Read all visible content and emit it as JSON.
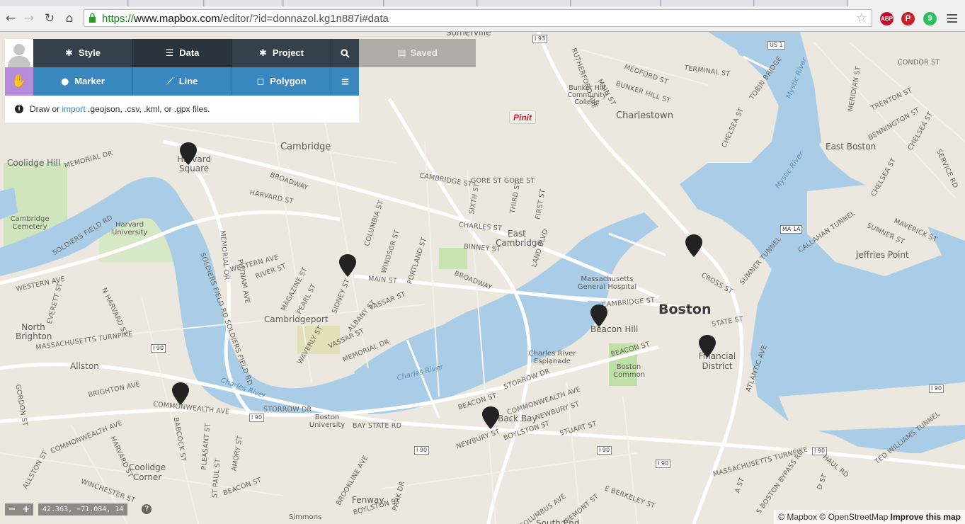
{
  "browser": {
    "url_scheme": "https://",
    "url_host": "www.mapbox.com",
    "url_path": "/editor/?id=donnazol.kg1n887i#data",
    "extensions": [
      {
        "icon": "adblock-icon",
        "label": "ABP",
        "color": "#c70d2c"
      },
      {
        "icon": "pinterest-icon",
        "label": "P",
        "color": "#cb2027"
      },
      {
        "icon": "evernote-icon",
        "label": "9",
        "color": "#2dbe60"
      }
    ]
  },
  "editor": {
    "nav": {
      "style": "Style",
      "data": "Data",
      "project": "Project",
      "saved": "Saved"
    },
    "tools": {
      "marker": "Marker",
      "line": "Line",
      "polygon": "Polygon"
    },
    "hint": {
      "prefix": "Draw or ",
      "link": "import",
      "suffix": " .geojson, .csv, .kml, or .gpx files."
    },
    "accent_color": "#3887be",
    "dark_color": "#34414d",
    "hand_color": "#b78bdb"
  },
  "map": {
    "pinit": "Pinit",
    "coords": "42.363, −71.084, 14",
    "zoom_in": "+",
    "zoom_out": "−",
    "help": "?",
    "attribution": {
      "mapbox": "© Mapbox",
      "osm": "© OpenStreetMap",
      "improve": "Improve this map"
    },
    "labels": {
      "boston": "Boston",
      "cambridge": "Cambridge",
      "charlestown": "Charlestown",
      "east_boston": "East Boston",
      "somerville": "Somerville",
      "harvard_square": "Harvard Square",
      "harvard_university": "Harvard University",
      "coolidge_hill": "Coolidge Hill",
      "cambridge_cemetery": "Cambridge Cemetery",
      "north_brighton": "North Brighton",
      "allston": "Allston",
      "cambridgeport": "Cambridgeport",
      "east_cambridge": "East Cambridge",
      "beacon_hill": "Beacon Hill",
      "back_bay": "Back Bay",
      "financial_district": "Financial District",
      "boston_common": "Boston Common",
      "boston_university": "Boston University",
      "mass_general": "Massachusetts General Hospital",
      "bunker_hill_college": "Bunker Hill Community College",
      "charles_river_esplanade": "Charles River Esplanade",
      "jeffries_point": "Jeffries Point",
      "coolidge_corner": "Coolidge Corner",
      "fenway": "Fenway",
      "simmons": "Simmons",
      "south_end": "South End",
      "charles_river": "Charles River",
      "mystic_river": "Mystic River"
    },
    "streets": {
      "memorial_dr": "MEMORIAL DR",
      "memorial_dr2": "MEMORIAL DR",
      "cambridge_st": "CAMBRIDGE ST",
      "cambridge_st2": "CAMBRIDGE ST",
      "broadway": "BROADWAY",
      "broadway2": "BROADWAY",
      "harvard_st": "HARVARD ST",
      "main_st": "MAIN ST",
      "massachusetts_tpk": "MASSACHUSETTS TURNPIKE",
      "massachusetts_tpk2": "MASSACHUSETTS TURNPIKE",
      "commonwealth_ave": "COMMONWEALTH AVE",
      "commonwealth_ave2": "COMMONWEALTH AVE",
      "commonwealth_ave3": "COMMONWEALTH AVE",
      "storrow_dr": "STORROW DR",
      "storrow_dr2": "STORROW DR",
      "beacon_st": "BEACON ST",
      "beacon_st2": "BEACON ST",
      "beacon_st3": "BEACON ST",
      "western_ave": "WESTERN AVE",
      "western_ave2": "WESTERN AVE",
      "soldiers_field_rd": "SOLDIERS FIELD RD",
      "soldiers_field_rd2": "SOLDIERS FIELD RD SOLDIERS FIELD RD",
      "vassar_st": "VASSAR ST",
      "vassar_st2": "VASSAR ST",
      "albany_st": "ALBANY ST",
      "sidney_st": "SIDNEY ST",
      "columbia_st": "COLUMBIA ST",
      "windsor_st": "WINDSOR ST",
      "portland_st": "PORTLAND ST",
      "gore_st": "GORE ST GORE ST",
      "charles_st": "CHARLES ST",
      "binney_st": "BINNEY ST",
      "land_blvd": "LAND BLVD",
      "sixth_st": "SIXTH ST",
      "third_st": "THIRD ST",
      "first_st": "FIRST ST",
      "river_st": "RIVER ST",
      "magazine_st": "MAGAZINE ST",
      "pearl_st": "PEARL ST",
      "waverly_st": "WAVERLY ST",
      "putnam_ave": "PUTNAM AVE",
      "memorial_dr_v": "MEMORIAL DR",
      "everett_st": "EVERETT ST",
      "n_harvard_st": "N HARVARD ST",
      "brighton_ave": "BRIGHTON AVE",
      "gordon_st": "GORDON ST",
      "babcock_st": "BABCOCK ST",
      "pleasant_st": "PLEASANT ST",
      "st_paul_st": "ST PAUL ST",
      "amory_st": "AMORY ST",
      "harvard_st2": "HARVARD ST",
      "allston_st": "ALLSTON ST",
      "winchester_st": "WINCHESTER ST",
      "newbury_st": "NEWBURY ST",
      "newbury_st2": "NEWBURY ST",
      "boylston_st": "BOYLSTON ST",
      "boylston_st2": "BOYLSTON ST",
      "stuart_st": "STUART ST",
      "bay_state_rd": "BAY STATE RD",
      "brookline_ave": "BROOKLINE AVE",
      "park_dr": "PARK DR",
      "columbus_ave": "COLUMBUS AVE",
      "tremont_st": "TREMONT ST",
      "e_berkeley_st": "E BERKELEY ST",
      "state_st": "STATE ST",
      "cross_st": "CROSS ST",
      "atlantic_ave": "ATLANTIC AVE",
      "sumner_tunnel": "SUMNER TUNNEL",
      "callahan_tunnel": "CALLAHAN TUNNEL",
      "sumner_st": "SUMNER ST",
      "maverick_st": "MAVERICK ST",
      "chelsea_st": "CHELSEA ST",
      "chelsea_st2": "CHELSEA ST",
      "chelsea_st3": "CHELSEA ST",
      "bennington_st": "BENNINGTON ST",
      "trenton_st": "TRENTON ST",
      "condor_st": "CONDOR ST",
      "meridian_st": "MERIDIAN ST",
      "terminal_st": "TERMINAL ST",
      "tobin_bridge": "TOBIN BRIDGE",
      "medford_st": "MEDFORD ST",
      "bunker_hill_st": "BUNKER HILL ST",
      "main_st2": "MAIN ST",
      "rutherford_ave": "RUTHERFORD AVE",
      "service_rd": "SERVICE RD",
      "ted_williams_tunnel": "TED WILLIAMS TUNNEL",
      "haul_rd": "HAUL RD",
      "s_boston_bypass": "S BOSTON BYPASS RD",
      "a_st": "A ST",
      "d_st": "D ST",
      "mass_tpk3": "MASSACHUSETTS TURNPIKE",
      "beacon_st4": "BEACON ST",
      "boylston_st3": "BOYLSTON ST"
    },
    "shields": {
      "i93_top": "I 93",
      "us1": "US 1",
      "i93_mid": "I 93",
      "us1_b": "US 1",
      "ma1a": "MA 1A",
      "i90_a": "I 90",
      "i90_b": "I 90",
      "i90_c": "I 90",
      "i90_d": "I 90",
      "i90_e": "I 90",
      "i90_f": "I 90",
      "i90_g": "I 90"
    }
  }
}
